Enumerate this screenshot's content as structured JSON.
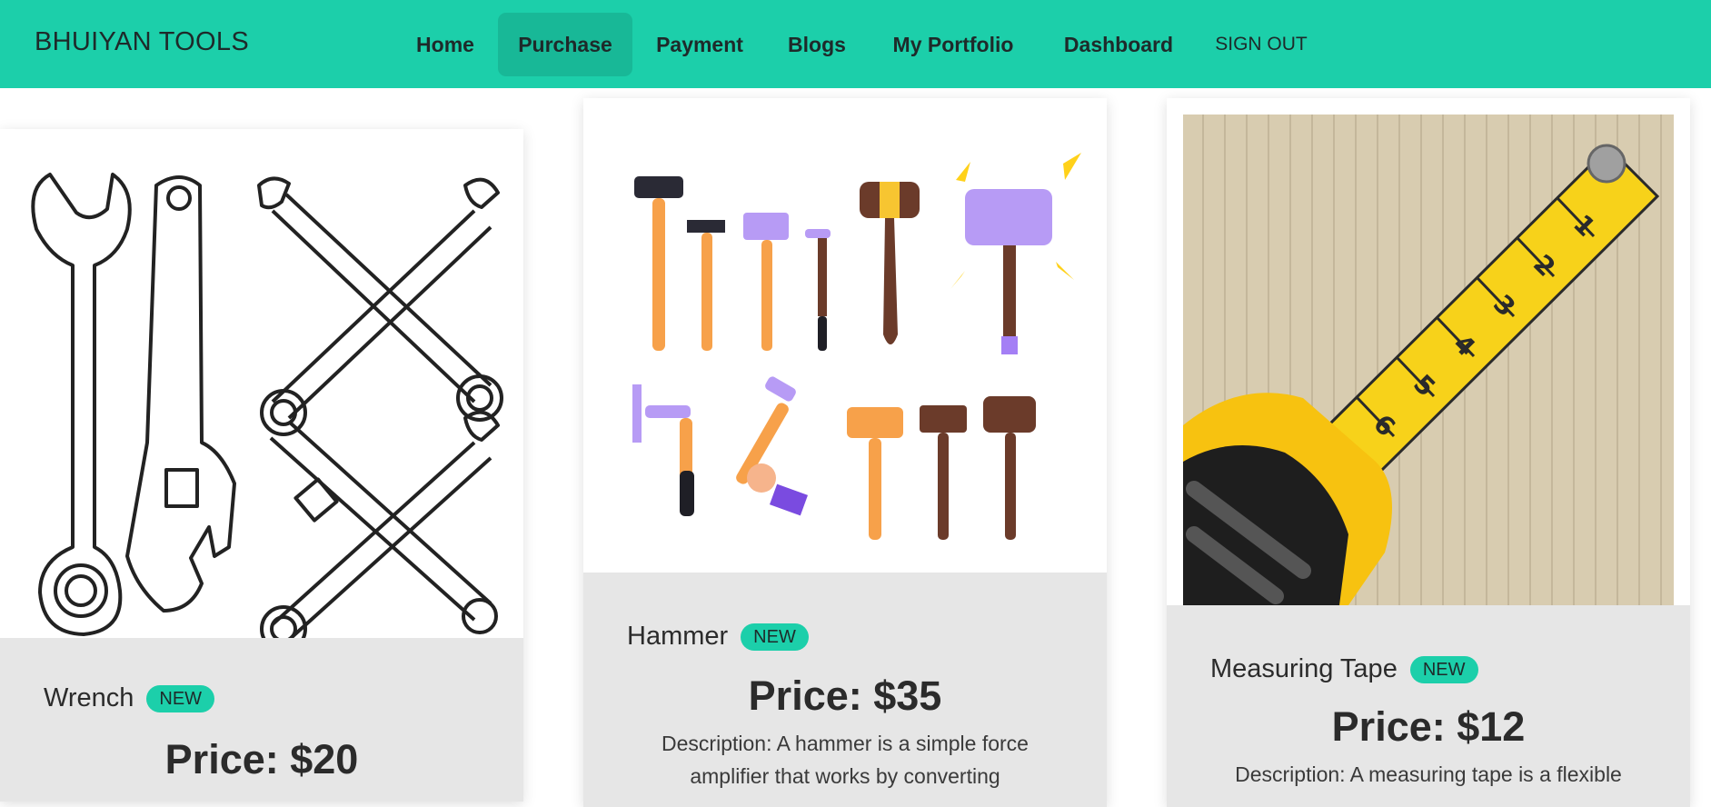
{
  "nav": {
    "brand": "BHUIYAN TOOLS",
    "items": [
      {
        "label": "Home"
      },
      {
        "label": "Purchase"
      },
      {
        "label": "Payment"
      },
      {
        "label": "Blogs"
      },
      {
        "label": "My Portfolio"
      },
      {
        "label": "Dashboard"
      }
    ],
    "signout": "SIGN OUT"
  },
  "products": [
    {
      "name": "Wrench",
      "badge": "NEW",
      "price": "Price: $20",
      "description": "",
      "image_icon": "wrench-set-icon"
    },
    {
      "name": "Hammer",
      "badge": "NEW",
      "price": "Price: $35",
      "description": "Description: A hammer is a simple force amplifier that works by converting",
      "image_icon": "hammer-set-icon"
    },
    {
      "name": "Measuring Tape",
      "badge": "NEW",
      "price": "Price: $12",
      "description": "Description: A measuring tape is a flexible",
      "image_icon": "measuring-tape-icon"
    }
  ],
  "colors": {
    "accent": "#1ccfaa",
    "accent_active": "#18b897",
    "card_bg": "#e6e6e6"
  }
}
